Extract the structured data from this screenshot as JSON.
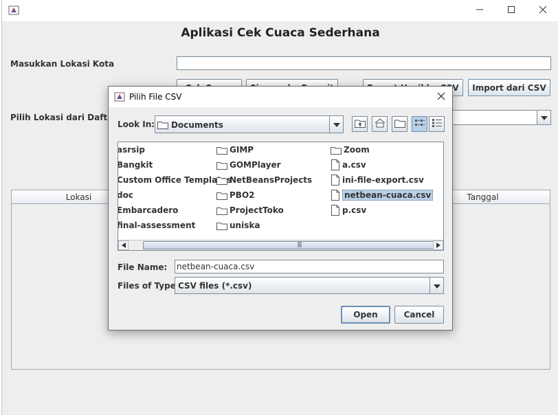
{
  "main": {
    "app_title": "Aplikasi Cek Cuaca Sederhana",
    "location_label": "Masukkan Lokasi Kota",
    "location_value": "",
    "buttons": {
      "check_weather": "Cek Cuaca",
      "save_favorite": "Simpan ke Favorit",
      "export_csv": "Export Hasil ke CSV",
      "import_csv": "Import dari CSV"
    },
    "favorite_label": "Pilih Lokasi dari Daftar Favorit",
    "favorite_value": "",
    "table_columns": [
      "Lokasi",
      "",
      "",
      "Tanggal"
    ]
  },
  "dialog": {
    "title": "Pilih File CSV",
    "look_in_label": "Look In:",
    "look_in_value": "Documents",
    "file_name_label": "File Name:",
    "file_name_value": "netbean-cuaca.csv",
    "file_type_label": "Files of Type:",
    "file_type_value": "CSV files (*.csv)",
    "open_button": "Open",
    "cancel_button": "Cancel",
    "files": [
      {
        "name": "asrsip",
        "type": "folder"
      },
      {
        "name": "Bangkit",
        "type": "folder"
      },
      {
        "name": "Custom Office Templates",
        "type": "folder"
      },
      {
        "name": "doc",
        "type": "folder"
      },
      {
        "name": "Embarcadero",
        "type": "folder"
      },
      {
        "name": "final-assessment",
        "type": "folder"
      },
      {
        "name": "GIMP",
        "type": "folder"
      },
      {
        "name": "GOMPlayer",
        "type": "folder"
      },
      {
        "name": "NetBeansProjects",
        "type": "folder"
      },
      {
        "name": "PBO2",
        "type": "folder"
      },
      {
        "name": "ProjectToko",
        "type": "folder"
      },
      {
        "name": "uniska",
        "type": "folder"
      },
      {
        "name": "Zoom",
        "type": "folder"
      },
      {
        "name": "a.csv",
        "type": "file"
      },
      {
        "name": "ini-file-export.csv",
        "type": "file"
      },
      {
        "name": "netbean-cuaca.csv",
        "type": "file",
        "selected": true
      },
      {
        "name": "p.csv",
        "type": "file"
      }
    ]
  }
}
